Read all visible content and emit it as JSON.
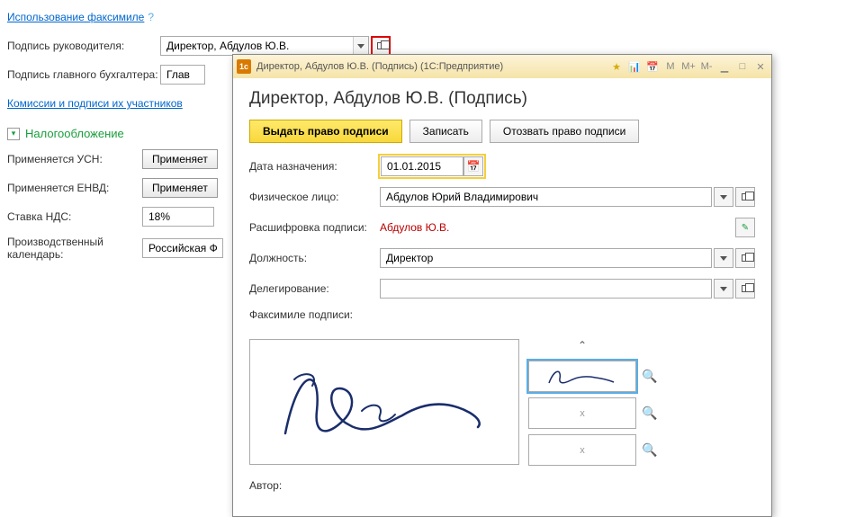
{
  "header": {
    "facsimile_link": "Использование факсимиле",
    "help_symbol": "?"
  },
  "form": {
    "sign_manager_label": "Подпись руководителя:",
    "sign_manager_value": "Директор, Абдулов Ю.В.",
    "sign_accountant_label": "Подпись главного бухгалтера:",
    "sign_accountant_value": "Глав",
    "commissions_link": "Комиссии и подписи их участников"
  },
  "tax": {
    "section": "Налогообложение",
    "usn_label": "Применяется УСН:",
    "usn_btn": "Применяет",
    "envd_label": "Применяется ЕНВД:",
    "envd_btn": "Применяет",
    "vat_label": "Ставка НДС:",
    "vat_value": "18%",
    "calendar_label": "Производственный календарь:",
    "calendar_value": "Российская Ф"
  },
  "modal": {
    "titlebar": "Директор, Абдулов Ю.В. (Подпись)   (1С:Предприятие)",
    "heading": "Директор, Абдулов Ю.В. (Подпись)",
    "btn_issue": "Выдать право подписи",
    "btn_save": "Записать",
    "btn_revoke": "Отозвать право подписи",
    "date_label": "Дата назначения:",
    "date_value": "01.01.2015",
    "person_label": "Физическое лицо:",
    "person_value": "Абдулов Юрий Владимирович",
    "decode_label": "Расшифровка подписи:",
    "decode_value": "Абдулов Ю.В.",
    "position_label": "Должность:",
    "position_value": "Директор",
    "delegation_label": "Делегирование:",
    "delegation_value": "",
    "facsimile_label": "Факсимиле подписи:",
    "thumb_x": "x",
    "author_label": "Автор:",
    "toolbar": {
      "m": "M",
      "mplus": "M+",
      "mminus": "M-"
    }
  }
}
